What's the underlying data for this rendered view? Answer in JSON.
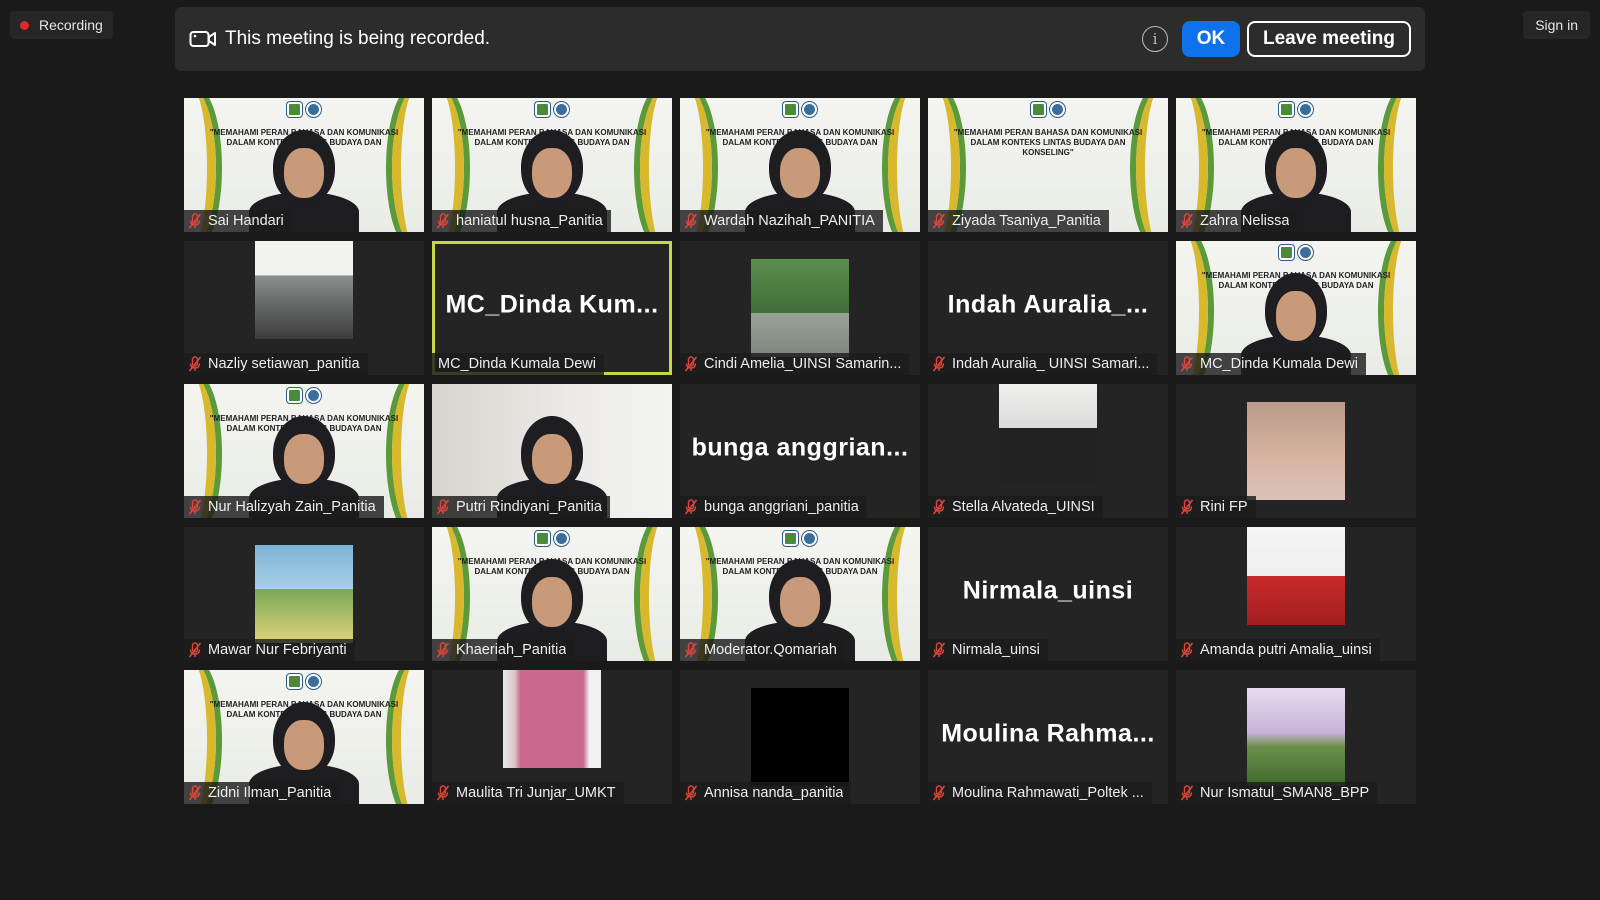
{
  "recording_indicator": {
    "label": "Recording",
    "color": "#e02828"
  },
  "sign_in": {
    "label": "Sign in"
  },
  "banner": {
    "message": "This meeting is being recorded.",
    "ok_label": "OK",
    "leave_label": "Leave meeting",
    "accent": "#0e72ed"
  },
  "webinar_banner_text": "\"MEMAHAMI PERAN BAHASA DAN KOMUNIKASI DALAM KONTEKS LINTAS BUDAYA DAN KONSELING\"",
  "participants": [
    {
      "name": "Sai Handari",
      "muted": true,
      "video": "banner-person"
    },
    {
      "name": "haniatul husna_Panitia",
      "muted": true,
      "video": "banner-person"
    },
    {
      "name": "Wardah Nazihah_PANITIA",
      "muted": true,
      "video": "banner-person"
    },
    {
      "name": "Ziyada Tsaniya_Panitia",
      "muted": true,
      "video": "banner"
    },
    {
      "name": "Zahra Nelissa",
      "muted": true,
      "video": "banner-person"
    },
    {
      "name": "Nazliy setiawan_panitia",
      "muted": true,
      "video": "snapshot"
    },
    {
      "name": "MC_Dinda Kumala Dewi",
      "muted": false,
      "video": "none",
      "display_name": "MC_Dinda Kum...",
      "active_speaker": true
    },
    {
      "name": "Cindi Amelia_UINSI Samarin...",
      "muted": true,
      "video": "snapshot"
    },
    {
      "name": "Indah Auralia_ UINSI Samari...",
      "muted": true,
      "video": "none",
      "display_name": "Indah Auralia_..."
    },
    {
      "name": "MC_Dinda Kumala Dewi",
      "muted": true,
      "video": "banner-person"
    },
    {
      "name": "Nur Halizyah Zain_Panitia",
      "muted": true,
      "video": "banner-person"
    },
    {
      "name": "Putri Rindiyani_Panitia",
      "muted": true,
      "video": "room-person"
    },
    {
      "name": "bunga anggriani_panitia",
      "muted": true,
      "video": "none",
      "display_name": "bunga anggrian..."
    },
    {
      "name": "Stella Alvateda_UINSI",
      "muted": true,
      "video": "snapshot"
    },
    {
      "name": "Rini FP",
      "muted": true,
      "video": "snapshot"
    },
    {
      "name": "Mawar Nur Febriyanti",
      "muted": true,
      "video": "snapshot"
    },
    {
      "name": "Khaeriah_Panitia",
      "muted": true,
      "video": "banner-person"
    },
    {
      "name": "Moderator.Qomariah",
      "muted": true,
      "video": "banner-person"
    },
    {
      "name": "Nirmala_uinsi",
      "muted": true,
      "video": "none",
      "display_name": "Nirmala_uinsi"
    },
    {
      "name": "Amanda putri Amalia_uinsi",
      "muted": true,
      "video": "snapshot"
    },
    {
      "name": "Zidni Ilman_Panitia",
      "muted": true,
      "video": "banner-person"
    },
    {
      "name": "Maulita Tri Junjar_UMKT",
      "muted": true,
      "video": "snapshot"
    },
    {
      "name": "Annisa nanda_panitia",
      "muted": true,
      "video": "snapshot"
    },
    {
      "name": "Moulina Rahmawati_Poltek ...",
      "muted": true,
      "video": "none",
      "display_name": "Moulina Rahma..."
    },
    {
      "name": "Nur Ismatul_SMAN8_BPP",
      "muted": true,
      "video": "snapshot"
    }
  ],
  "icons": {
    "camera": "camera-icon",
    "info": "info-icon",
    "mute": "mic-muted-icon"
  },
  "colors": {
    "active_speaker": "#c6d74a",
    "muted_mic": "#e0453a",
    "tile_bg": "#242424"
  }
}
